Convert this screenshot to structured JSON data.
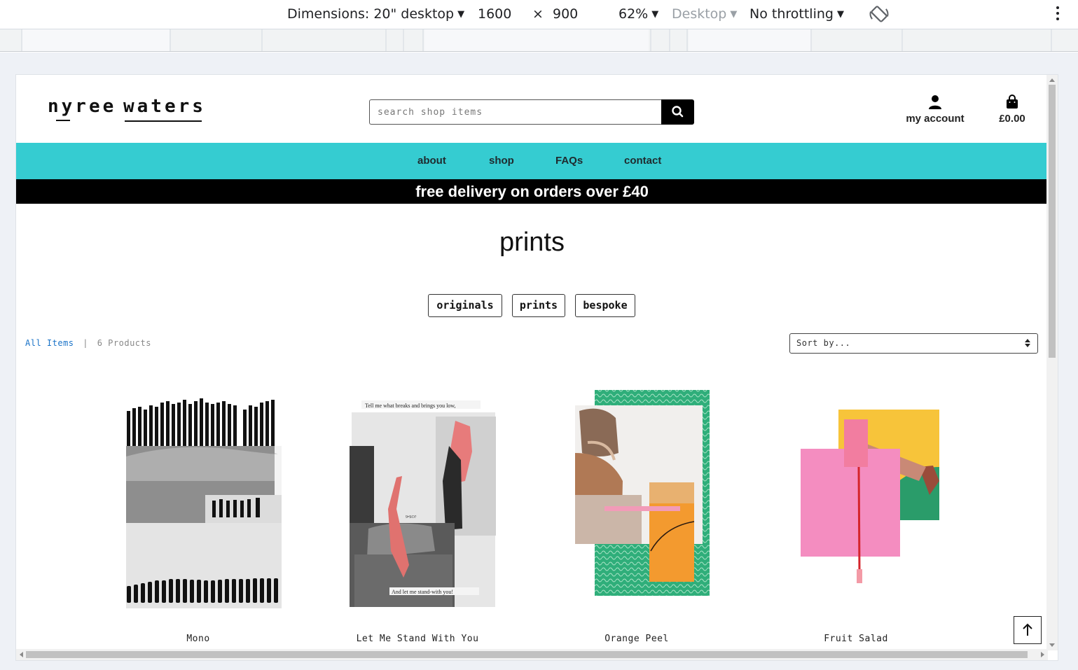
{
  "devtools": {
    "dimensions_label": "Dimensions: 20\" desktop",
    "width": "1600",
    "times": "×",
    "height": "900",
    "zoom": "62%",
    "device_type": "Desktop",
    "throttling": "No throttling",
    "rotate_icon": "rotate-icon",
    "more_icon": "kebab-menu-icon"
  },
  "site": {
    "logo_word1": "nyree",
    "logo_word2": "waters",
    "search_placeholder": "search shop items",
    "search_icon": "search-icon",
    "account_label": "my account",
    "basket_total": "£0.00",
    "nav": [
      "about",
      "shop",
      "FAQs",
      "contact"
    ],
    "promo": "free delivery on orders over £40"
  },
  "page": {
    "title": "prints",
    "categories": [
      "originals",
      "prints",
      "bespoke"
    ],
    "breadcrumb_link": "All Items",
    "separator": "|",
    "product_count": "6 Products",
    "sort_label": "Sort by..."
  },
  "products": [
    {
      "name": "Mono"
    },
    {
      "name": "Let Me Stand With You",
      "art_top_text": "Tell   me what breaks and    brings   you  low,",
      "art_bottom_text": "And let me stand-with   you!",
      "art_small_text": "9•SO?"
    },
    {
      "name": "Orange Peel"
    },
    {
      "name": "Fruit Salad"
    }
  ],
  "colors": {
    "nav_bg": "#35ccd1",
    "promo_bg": "#000000",
    "link": "#1a73c8"
  }
}
